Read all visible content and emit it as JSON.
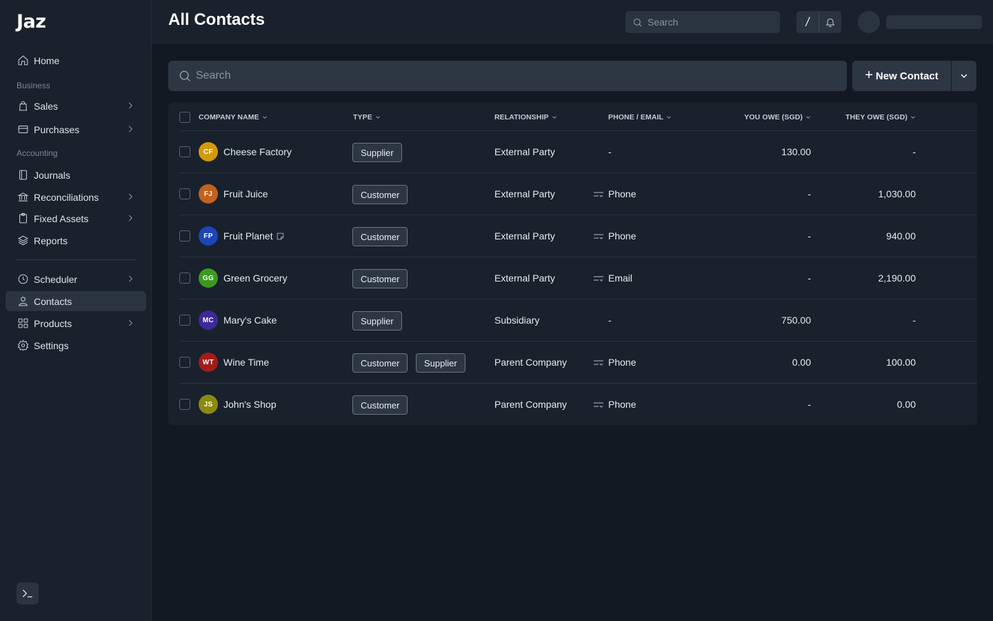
{
  "app": {
    "logo": "Jaz"
  },
  "sidebar": {
    "home": "Home",
    "business_label": "Business",
    "sales": "Sales",
    "purchases": "Purchases",
    "accounting_label": "Accounting",
    "journals": "Journals",
    "reconciliations": "Reconciliations",
    "fixed_assets": "Fixed Assets",
    "reports": "Reports",
    "scheduler": "Scheduler",
    "contacts": "Contacts",
    "products": "Products",
    "settings": "Settings"
  },
  "header": {
    "title": "All Contacts",
    "search_placeholder": "Search",
    "shortcut": "/"
  },
  "toolbar": {
    "search_placeholder": "Search",
    "new_contact": "New Contact"
  },
  "table": {
    "columns": {
      "company": "COMPANY NAME",
      "type": "TYPE",
      "relationship": "RELATIONSHIP",
      "phone_email": "PHONE / EMAIL",
      "you_owe": "YOU OWE (SGD)",
      "they_owe": "THEY OWE (SGD)"
    },
    "rows": [
      {
        "initials": "CF",
        "avatar_color": "#d49a0c",
        "name": "Cheese Factory",
        "types": [
          "Supplier"
        ],
        "relationship": "External Party",
        "contact": "-",
        "you_owe": "130.00",
        "they_owe": "-"
      },
      {
        "initials": "FJ",
        "avatar_color": "#c2621e",
        "name": "Fruit Juice",
        "types": [
          "Customer"
        ],
        "relationship": "External Party",
        "contact": "Phone",
        "you_owe": "-",
        "they_owe": "1,030.00"
      },
      {
        "initials": "FP",
        "avatar_color": "#1c45b8",
        "name": "Fruit Planet",
        "types": [
          "Customer"
        ],
        "relationship": "External Party",
        "contact": "Phone",
        "you_owe": "-",
        "they_owe": "940.00"
      },
      {
        "initials": "GG",
        "avatar_color": "#3c9a21",
        "name": "Green Grocery",
        "types": [
          "Customer"
        ],
        "relationship": "External Party",
        "contact": "Email",
        "you_owe": "-",
        "they_owe": "2,190.00"
      },
      {
        "initials": "MC",
        "avatar_color": "#3d2a9a",
        "name": "Mary's Cake",
        "types": [
          "Supplier"
        ],
        "relationship": "Subsidiary",
        "contact": "-",
        "you_owe": "750.00",
        "they_owe": "-"
      },
      {
        "initials": "WT",
        "avatar_color": "#a31c1c",
        "name": "Wine Time",
        "types": [
          "Customer",
          "Supplier"
        ],
        "relationship": "Parent Company",
        "contact": "Phone",
        "you_owe": "0.00",
        "they_owe": "100.00"
      },
      {
        "initials": "JS",
        "avatar_color": "#8a8a10",
        "name": "John's Shop",
        "types": [
          "Customer"
        ],
        "relationship": "Parent Company",
        "contact": "Phone",
        "you_owe": "-",
        "they_owe": "0.00"
      }
    ]
  }
}
